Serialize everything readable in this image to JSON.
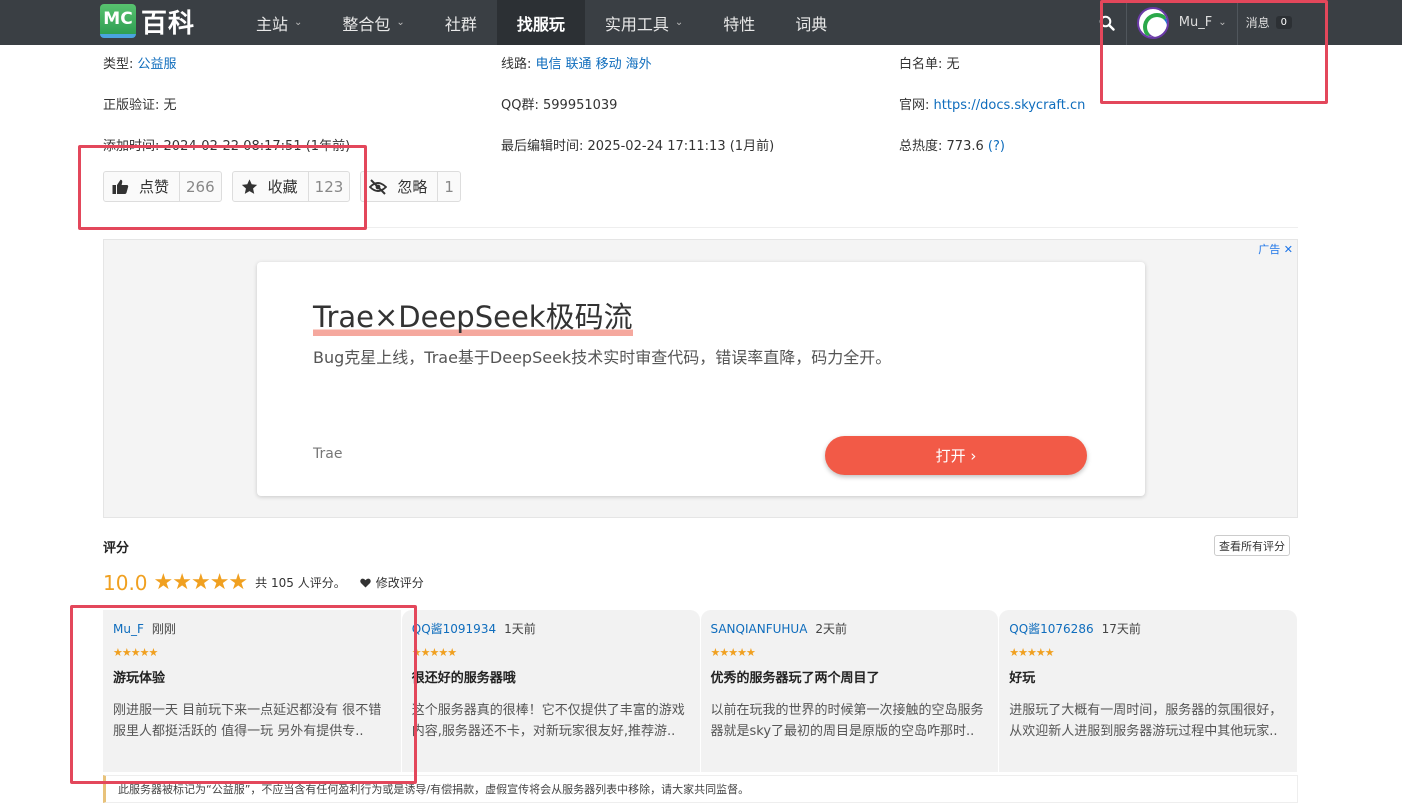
{
  "header": {
    "logo_mc": "MC",
    "logo_text": "百科",
    "nav": [
      {
        "label": "主站",
        "caret": "⌄"
      },
      {
        "label": "整合包",
        "caret": "⌄"
      },
      {
        "label": "社群",
        "caret": ""
      },
      {
        "label": "找服玩",
        "caret": ""
      },
      {
        "label": "实用工具",
        "caret": "⌄"
      },
      {
        "label": "特性",
        "caret": ""
      },
      {
        "label": "词典",
        "caret": ""
      }
    ],
    "active_nav": "找服玩",
    "username": "Mu_F",
    "messages_label": "消息",
    "messages_count": "0"
  },
  "info": {
    "type_label": "类型:",
    "type_value": "公益服",
    "route_label": "线路:",
    "routes": [
      "电信",
      "联通",
      "移动",
      "海外"
    ],
    "whitelist_label": "白名单:",
    "whitelist_value": "无",
    "premium_label": "正版验证:",
    "premium_value": "无",
    "qq_label": "QQ群:",
    "qq_value": "599951039",
    "site_label": "官网:",
    "site_value": "https://docs.skycraft.cn",
    "added_label": "添加时间:",
    "added_value": "2024-02-22 08:17:51 (1年前)",
    "edited_label": "最后编辑时间:",
    "edited_value": "2025-02-24 17:11:13 (1月前)",
    "heat_label": "总热度:",
    "heat_value": "773.6",
    "heat_help": "(?)"
  },
  "actions": {
    "like_label": "点赞",
    "like_count": "266",
    "fav_label": "收藏",
    "fav_count": "123",
    "ignore_label": "忽略",
    "ignore_count": "1"
  },
  "ad": {
    "tag": "广告 ✕",
    "title": "Trae×DeepSeek极码流",
    "desc": "Bug克星上线，Trae基于DeepSeek技术实时审查代码，错误率直降，码力全开。",
    "brand": "Trae",
    "button": "打开 ›"
  },
  "rating": {
    "title": "评分",
    "view_all": "查看所有评分",
    "score": "10.0",
    "stars": "★★★★★",
    "total": "共 105 人评分。",
    "edit": "修改评分"
  },
  "reviews": [
    {
      "user": "Mu_F",
      "time": "刚刚",
      "stars": "★★★★★",
      "title": "游玩体验",
      "body": "刚进服一天 目前玩下来一点延迟都没有 很不错 服里人都挺活跃的 值得一玩 另外有提供专.."
    },
    {
      "user": "QQ酱1091934",
      "time": "1天前",
      "stars": "★★★★★",
      "title": "很还好的服务器哦",
      "body": "这个服务器真的很棒！它不仅提供了丰富的游戏内容,服务器还不卡，对新玩家很友好,推荐游.."
    },
    {
      "user": "SANQIANFUHUA",
      "time": "2天前",
      "stars": "★★★★★",
      "title": "优秀的服务器玩了两个周目了",
      "body": "以前在玩我的世界的时候第一次接触的空岛服务器就是sky了最初的周目是原版的空岛咋那时.."
    },
    {
      "user": "QQ酱1076286",
      "time": "17天前",
      "stars": "★★★★★",
      "title": "好玩",
      "body": "进服玩了大概有一周时间，服务器的氛围很好，从欢迎新人进服到服务器游玩过程中其他玩家.."
    }
  ],
  "notice": "此服务器被标记为“公益服”，不应当含有任何盈利行为或是诱导/有偿捐款，虚假宣传将会从服务器列表中移除，请大家共同监督。",
  "colors": {
    "nav_bg": "#3a3f44",
    "link": "#0f6dbd",
    "star": "#f0a020",
    "ad_button": "#f25a47",
    "highlight_box": "#e3475b"
  }
}
